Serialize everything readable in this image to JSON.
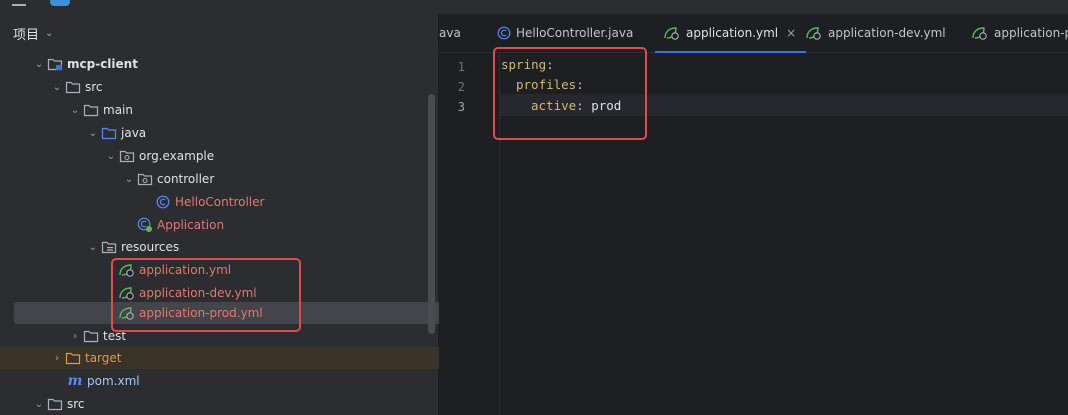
{
  "colors": {
    "background": "#1e1f22",
    "panel": "#2b2d30",
    "accent_blue": "#3574f0",
    "yaml_key": "#d5b778",
    "modified_file": "#e07a6c",
    "excluded_folder": "#d99755",
    "annotation_red": "#e5484d"
  },
  "project_panel": {
    "title": "项目",
    "tree": [
      {
        "label": "mcp-client",
        "icon": "module-folder-icon",
        "expanded": true
      },
      {
        "label": "src",
        "icon": "folder-icon",
        "expanded": true
      },
      {
        "label": "main",
        "icon": "folder-icon",
        "expanded": true
      },
      {
        "label": "java",
        "icon": "source-folder-icon",
        "expanded": true
      },
      {
        "label": "org.example",
        "icon": "package-icon",
        "expanded": true
      },
      {
        "label": "controller",
        "icon": "package-icon",
        "expanded": true
      },
      {
        "label": "HelloController",
        "icon": "class-icon"
      },
      {
        "label": "Application",
        "icon": "spring-boot-class-icon"
      },
      {
        "label": "resources",
        "icon": "resources-folder-icon",
        "expanded": true
      },
      {
        "label": "application.yml",
        "icon": "spring-yaml-icon"
      },
      {
        "label": "application-dev.yml",
        "icon": "spring-yaml-icon"
      },
      {
        "label": "application-prod.yml",
        "icon": "spring-yaml-icon",
        "selected": true
      },
      {
        "label": "test",
        "icon": "folder-icon",
        "expanded": false
      },
      {
        "label": "target",
        "icon": "excluded-folder-icon",
        "expanded": false
      },
      {
        "label": "pom.xml",
        "icon": "maven-icon"
      },
      {
        "label": "src",
        "icon": "folder-icon",
        "expanded": true
      }
    ]
  },
  "editor": {
    "tabs": [
      {
        "label": "ava",
        "icon": ""
      },
      {
        "label": "HelloController.java",
        "icon": "class-icon"
      },
      {
        "label": "application.yml",
        "icon": "spring-yaml-icon",
        "active": true,
        "close": "×"
      },
      {
        "label": "application-dev.yml",
        "icon": "spring-yaml-icon"
      },
      {
        "label": "application-pr",
        "icon": "spring-yaml-icon"
      }
    ],
    "line_numbers": [
      "1",
      "2",
      "3"
    ],
    "current_line": 3,
    "code": [
      {
        "key": "spring",
        "colon": ":",
        "value": ""
      },
      {
        "key": "profiles",
        "colon": ":",
        "value": ""
      },
      {
        "key": "active",
        "colon": ":",
        "value": " prod"
      }
    ]
  }
}
